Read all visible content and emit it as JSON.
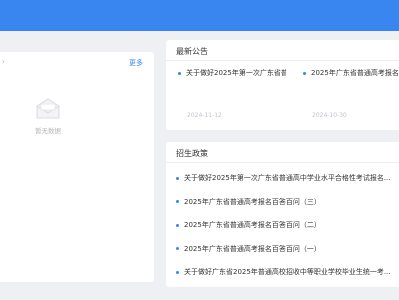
{
  "left_panel": {
    "more_label": "更多",
    "empty_label": "暂无数据",
    "icon": "empty-envelope-icon"
  },
  "announcements": {
    "title": "最新公告",
    "items": [
      {
        "title": "关于做好2025年第一次广东省普",
        "date": "2024-11-12"
      },
      {
        "title": "2025年广东省普通高考报名",
        "date": "2024-10-30"
      }
    ]
  },
  "policies": {
    "title": "招生政策",
    "items": [
      "关于做好2025年第一次广东省普通高中学业水平合格性考试报名...",
      "2025年广东省普通高考报名百答百问（三）",
      "2025年广东省普通高考报名百答百问（二）",
      "2025年广东省普通高考报名百答百问（一）",
      "关于做好广东省2025年普通高校招收中等职业学校毕业生统一考..."
    ]
  },
  "colors": {
    "accent": "#3a86f0",
    "page_bg": "#eef0f4"
  }
}
